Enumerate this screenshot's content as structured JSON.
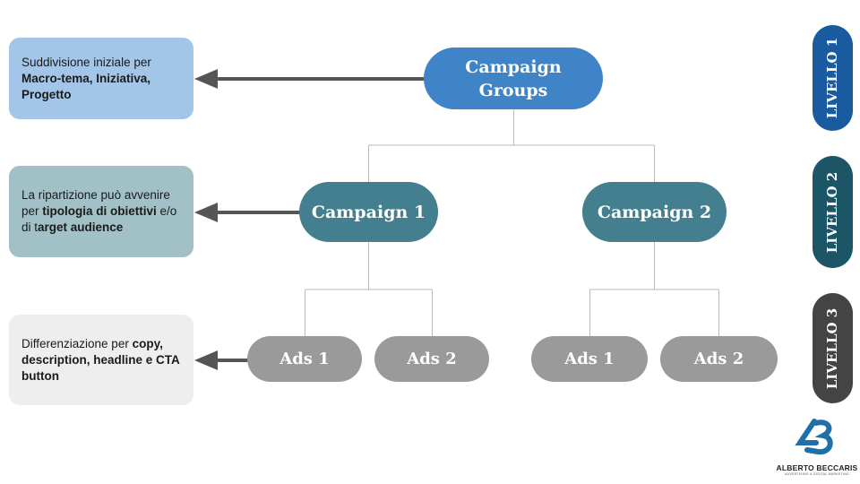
{
  "notes": [
    {
      "plain_1": "Suddivisione iniziale per ",
      "bold_1": "Macro-tema, Iniziativa, Progetto"
    },
    {
      "plain_1": "La ripartizione può avvenire per ",
      "bold_1": "tipologia di obiettivi",
      "plain_2": " e/o di t",
      "bold_2": "arget audience"
    },
    {
      "plain_1": "Differenziazione per ",
      "bold_1": "copy, description, headline e CTA button"
    }
  ],
  "tree": {
    "root": {
      "line1": "Campaign",
      "line2": "Groups"
    },
    "campaigns": [
      "Campaign 1",
      "Campaign 2"
    ],
    "ads": [
      "Ads 1",
      "Ads 2",
      "Ads 1",
      "Ads 2"
    ]
  },
  "levels": [
    "LIVELLO 1",
    "LIVELLO 2",
    "LIVELLO 3"
  ],
  "logo": {
    "name": "ALBERTO BECCARIS",
    "tagline": "ADVERTISING & DIGITAL MARKETING"
  },
  "colors": {
    "root": "#3f84c7",
    "campaign": "#437f8e",
    "ads": "#9a9a9a",
    "level1": "#1a5a9e",
    "level2": "#1c5566",
    "level3": "#444444",
    "arrow": "#555555",
    "connector": "#bbbbbb"
  }
}
